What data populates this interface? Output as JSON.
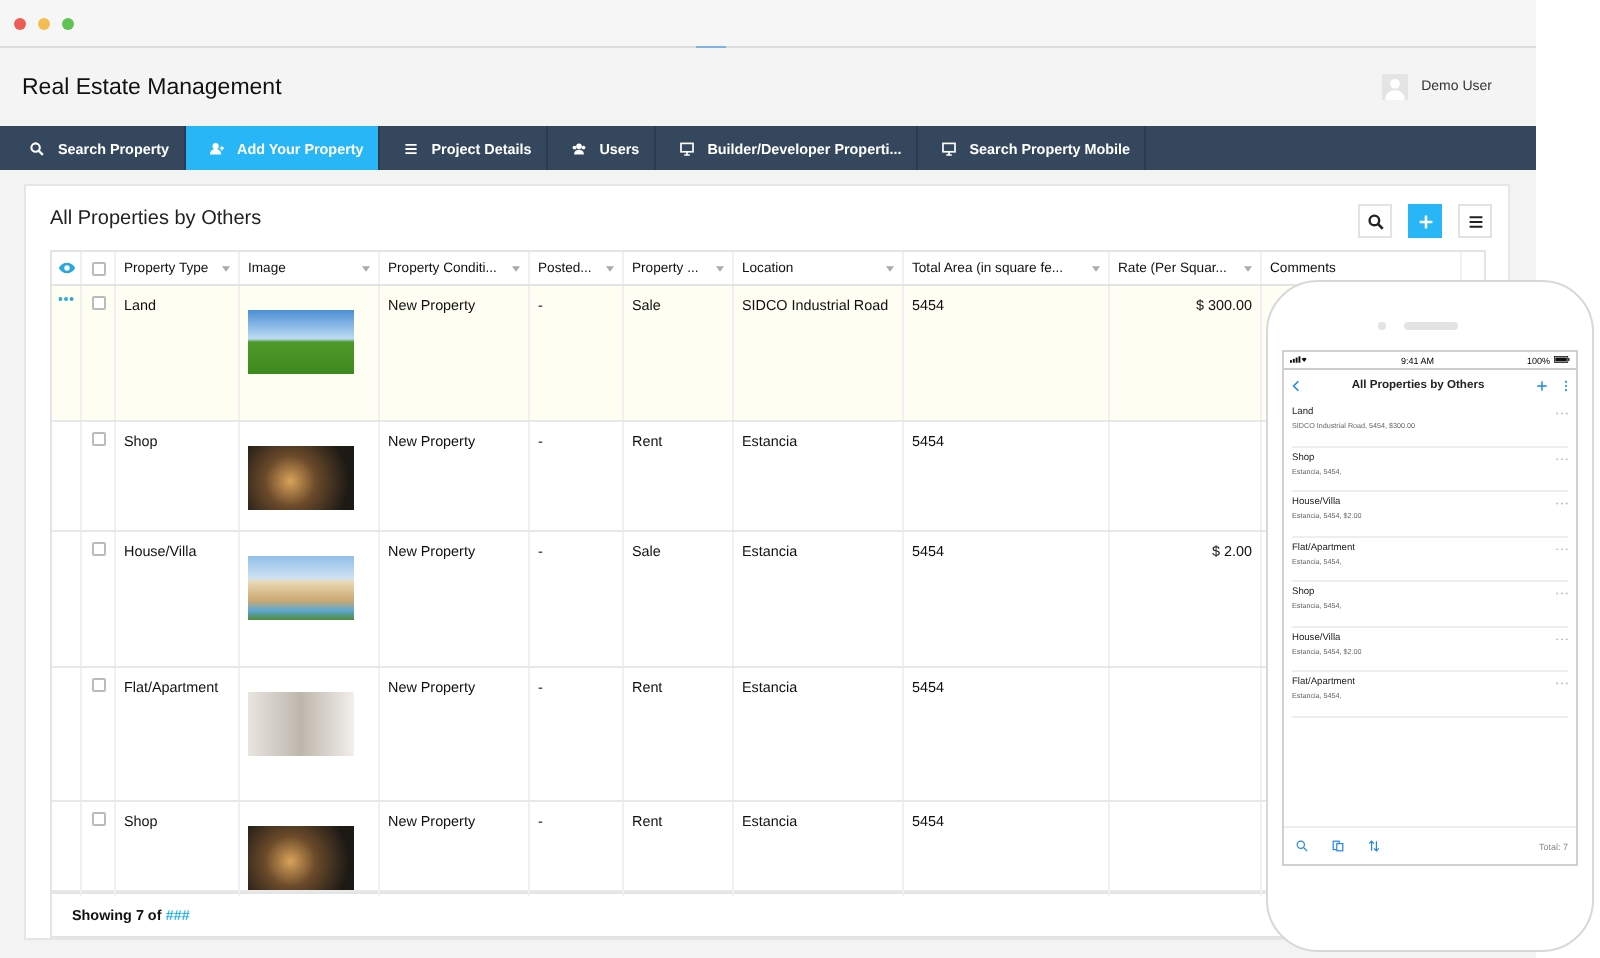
{
  "window": {
    "title": "Real Estate Management"
  },
  "user": {
    "name": "Demo User"
  },
  "nav": [
    {
      "label": "Search Property",
      "kind": "search",
      "selected": false
    },
    {
      "label": "Add Your Property",
      "kind": "user",
      "selected": true
    },
    {
      "label": "Project Details",
      "kind": "list",
      "selected": false
    },
    {
      "label": "Users",
      "kind": "users",
      "selected": false
    },
    {
      "label": "Builder/Developer Properti...",
      "kind": "monitor",
      "selected": false
    },
    {
      "label": "Search Property Mobile",
      "kind": "monitor",
      "selected": false
    }
  ],
  "panel": {
    "title": "All Properties by Others"
  },
  "table": {
    "select_all_checked": false,
    "columns": [
      "Property Type",
      "Image",
      "Property Conditi...",
      "Posted...",
      "Property ...",
      "Location",
      "Total Area (in square fe...",
      "Rate (Per Squar...",
      "Comments"
    ],
    "rows": [
      {
        "selected": true,
        "checked": false,
        "type": "Land",
        "condition": "New Property",
        "posted": "-",
        "property": "Sale",
        "location": "SIDCO Industrial Road",
        "area": "5454",
        "rate": "$ 300.00"
      },
      {
        "selected": false,
        "checked": false,
        "type": "Shop",
        "condition": "New Property",
        "posted": "-",
        "property": "Rent",
        "location": "Estancia",
        "area": "5454"
      },
      {
        "selected": false,
        "checked": false,
        "type": "House/Villa",
        "condition": "New Property",
        "posted": "-",
        "property": "Sale",
        "location": "Estancia",
        "area": "5454",
        "rate": "$ 2.00"
      },
      {
        "selected": false,
        "checked": false,
        "type": "Flat/Apartment",
        "condition": "New Property",
        "posted": "-",
        "property": "Rent",
        "location": "Estancia",
        "area": "5454"
      },
      {
        "selected": false,
        "checked": false,
        "type": "Shop",
        "condition": "New Property",
        "posted": "-",
        "property": "Rent",
        "location": "Estancia",
        "area": "5454"
      }
    ],
    "footer": {
      "label": "Showing 7 of",
      "link": "###"
    }
  },
  "phone": {
    "time": "9:41 AM",
    "battery": "100%",
    "title": "All Properties by Others",
    "items": [
      {
        "title": "Land",
        "subtitle": "SIDCO Industrial Road, 5454, $300.00"
      },
      {
        "title": "Shop",
        "subtitle": "Estancia, 5454,"
      },
      {
        "title": "House/Villa",
        "subtitle": "Estancia, 5454, $2.00"
      },
      {
        "title": "Flat/Apartment",
        "subtitle": "Estancia, 5454,"
      },
      {
        "title": "Shop",
        "subtitle": "Estancia, 5454,"
      },
      {
        "title": "House/Villa",
        "subtitle": "Estancia, 5454, $2.00"
      },
      {
        "title": "Flat/Apartment",
        "subtitle": "Estancia, 5454,"
      }
    ],
    "total": "Total: 7"
  }
}
